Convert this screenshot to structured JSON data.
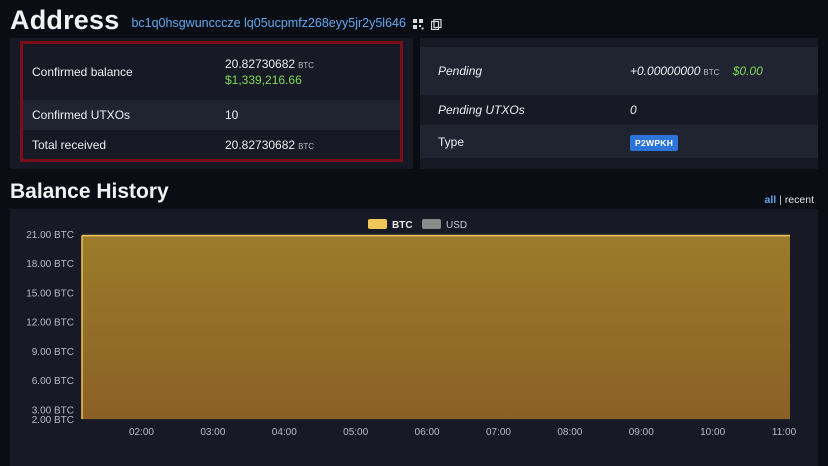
{
  "header": {
    "title": "Address",
    "address": "bc1q0hsgwuncccze lq05ucpmfz268eyy5jr2y5l646"
  },
  "summary": {
    "confirmed_balance_label": "Confirmed balance",
    "confirmed_balance_btc": "20.82730682",
    "confirmed_balance_usd": "$1,339,216.66",
    "confirmed_utxos_label": "Confirmed UTXOs",
    "confirmed_utxos": "10",
    "total_received_label": "Total received",
    "total_received_btc": "20.82730682",
    "unit": "BTC"
  },
  "pending": {
    "pending_label": "Pending",
    "pending_btc": "+0.00000000",
    "pending_usd": "$0.00",
    "pending_utxos_label": "Pending UTXOs",
    "pending_utxos": "0",
    "type_label": "Type",
    "type_badge": "P2WPKH"
  },
  "balance_history": {
    "title": "Balance History",
    "range_all": "all",
    "range_sep": "|",
    "range_recent": "recent"
  },
  "colors": {
    "accent": "#5fa8ee",
    "btc_series": "#f0c65a",
    "usd_series": "#8a8a8a",
    "highlight_border": "#7a0f1a"
  },
  "chart_data": {
    "type": "area",
    "legend": [
      "BTC",
      "USD"
    ],
    "legend_position": "top-center",
    "x": [
      "01:10",
      "02:00",
      "03:00",
      "04:00",
      "05:00",
      "06:00",
      "07:00",
      "08:00",
      "09:00",
      "10:00",
      "11:00",
      "11:05"
    ],
    "x_tick_labels": [
      "02:00",
      "03:00",
      "04:00",
      "05:00",
      "06:00",
      "07:00",
      "08:00",
      "09:00",
      "10:00",
      "11:00"
    ],
    "series": [
      {
        "name": "BTC",
        "values": [
          20.83,
          20.83,
          20.83,
          20.83,
          20.83,
          20.83,
          20.83,
          20.83,
          20.83,
          20.83,
          20.83,
          20.83
        ]
      }
    ],
    "y_tick_labels": [
      "21.00 BTC",
      "18.00 BTC",
      "15.00 BTC",
      "12.00 BTC",
      "9.00 BTC",
      "6.00 BTC",
      "3.00 BTC",
      "2.00 BTC"
    ],
    "y_ticks": [
      21,
      18,
      15,
      12,
      9,
      6,
      3,
      2
    ],
    "ylim": [
      2,
      21
    ],
    "grid": true
  }
}
